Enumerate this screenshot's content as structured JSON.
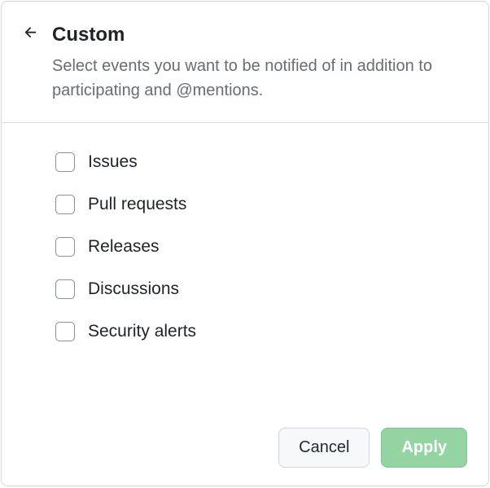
{
  "header": {
    "title": "Custom",
    "description": "Select events you want to be notified of in addition to participating and @mentions."
  },
  "options": [
    {
      "label": "Issues",
      "checked": false
    },
    {
      "label": "Pull requests",
      "checked": false
    },
    {
      "label": "Releases",
      "checked": false
    },
    {
      "label": "Discussions",
      "checked": false
    },
    {
      "label": "Security alerts",
      "checked": false
    }
  ],
  "footer": {
    "cancel_label": "Cancel",
    "apply_label": "Apply"
  }
}
